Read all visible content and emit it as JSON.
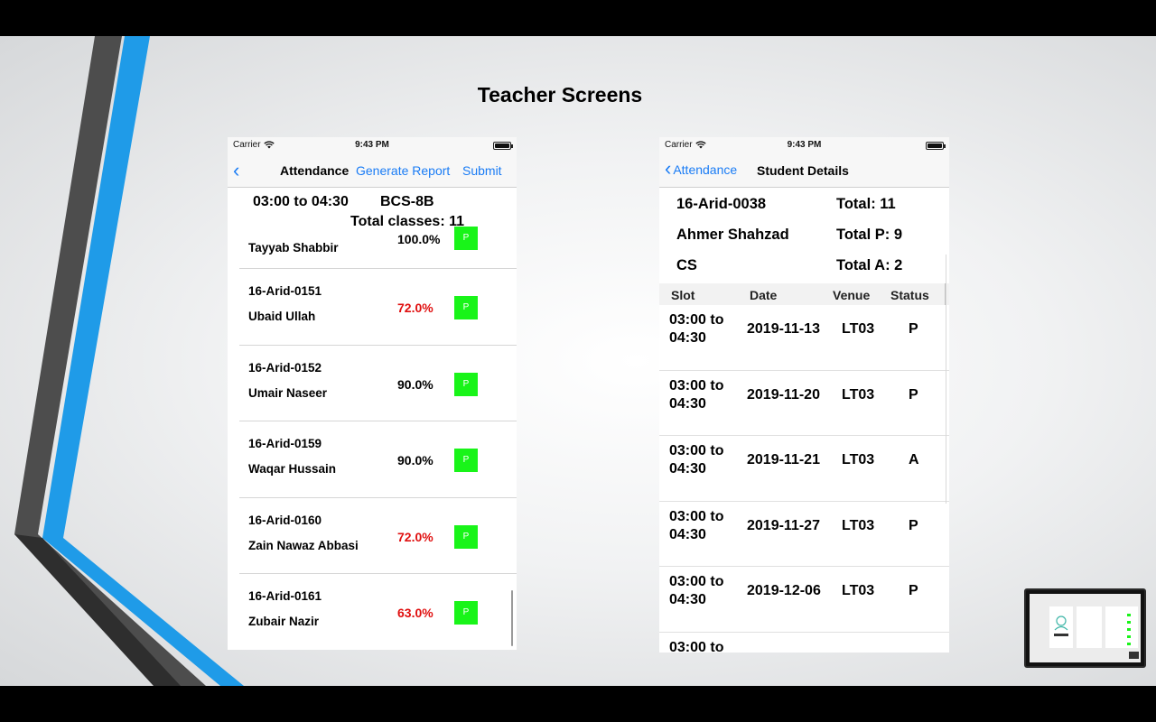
{
  "slide": {
    "title": "Teacher Screens"
  },
  "left_phone": {
    "status": {
      "carrier": "Carrier",
      "time": "9:43 PM"
    },
    "nav": {
      "title": "Attendance",
      "generate_report": "Generate Report",
      "submit": "Submit"
    },
    "class_info": {
      "slot": "03:00 to 04:30",
      "section": "BCS-8B",
      "total": "Total classes: 11"
    },
    "students": [
      {
        "roll": "",
        "name": "Tayyab Shabbir",
        "percent": "100.0%",
        "low": false,
        "mark": "P"
      },
      {
        "roll": "16-Arid-0151",
        "name": "Ubaid Ullah",
        "percent": "72.0%",
        "low": true,
        "mark": "P"
      },
      {
        "roll": "16-Arid-0152",
        "name": "Umair Naseer",
        "percent": "90.0%",
        "low": false,
        "mark": "P"
      },
      {
        "roll": "16-Arid-0159",
        "name": "Waqar Hussain",
        "percent": "90.0%",
        "low": false,
        "mark": "P"
      },
      {
        "roll": "16-Arid-0160",
        "name": "Zain Nawaz Abbasi",
        "percent": "72.0%",
        "low": true,
        "mark": "P"
      },
      {
        "roll": "16-Arid-0161",
        "name": "Zubair Nazir",
        "percent": "63.0%",
        "low": true,
        "mark": "P"
      }
    ]
  },
  "right_phone": {
    "status": {
      "carrier": "Carrier",
      "time": "9:43 PM"
    },
    "nav": {
      "back": "Attendance",
      "title": "Student Details"
    },
    "student": {
      "roll": "16-Arid-0038",
      "name": "Ahmer Shahzad",
      "dept": "CS",
      "total": "Total: 11",
      "total_p": "Total P: 9",
      "total_a": "Total A: 2"
    },
    "columns": {
      "slot": "Slot",
      "date": "Date",
      "venue": "Venue",
      "status": "Status"
    },
    "records": [
      {
        "slot": "03:00 to 04:30",
        "date": "2019-11-13",
        "venue": "LT03",
        "status": "P"
      },
      {
        "slot": "03:00 to 04:30",
        "date": "2019-11-20",
        "venue": "LT03",
        "status": "P"
      },
      {
        "slot": "03:00 to 04:30",
        "date": "2019-11-21",
        "venue": "LT03",
        "status": "A"
      },
      {
        "slot": "03:00 to 04:30",
        "date": "2019-11-27",
        "venue": "LT03",
        "status": "P"
      },
      {
        "slot": "03:00 to 04:30",
        "date": "2019-12-06",
        "venue": "LT03",
        "status": "P"
      },
      {
        "slot": "03:00 to",
        "date": "",
        "venue": "",
        "status": ""
      }
    ]
  },
  "colors": {
    "accent_blue": "#1a7cf5",
    "present_green": "#19f419",
    "low_red": "#e01010",
    "deco_gray": "#4a4a4a",
    "deco_blue": "#1f9be8"
  },
  "icons": [
    "wifi-icon",
    "battery-icon",
    "back-chevron-icon"
  ]
}
